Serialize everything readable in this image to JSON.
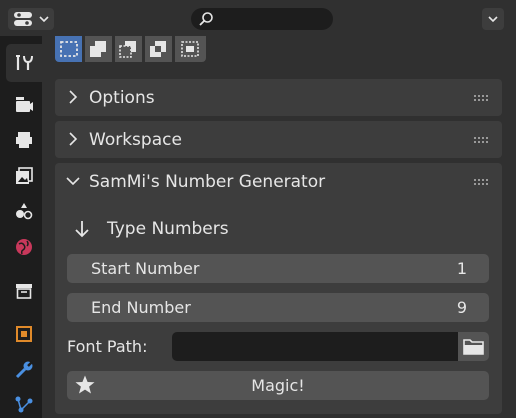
{
  "header": {
    "editor_type_icon": "properties-editor-icon",
    "search": {
      "value": "",
      "placeholder": ""
    },
    "menu_icon": "chevron-down-icon"
  },
  "tabs": [
    {
      "icon": "tool-icon",
      "active": true
    },
    {
      "icon": "render-icon",
      "active": false
    },
    {
      "icon": "output-icon",
      "active": false
    },
    {
      "icon": "view-layer-icon",
      "active": false
    },
    {
      "icon": "scene-icon",
      "active": false
    },
    {
      "icon": "world-icon",
      "active": false
    },
    {
      "icon": "collection-icon",
      "active": false
    },
    {
      "icon": "object-icon",
      "active": false
    },
    {
      "icon": "modifier-icon",
      "active": false
    },
    {
      "icon": "particles-icon",
      "active": false
    }
  ],
  "selection_modes": [
    {
      "icon": "select-new-icon",
      "selected": true
    },
    {
      "icon": "select-extend-icon",
      "selected": false
    },
    {
      "icon": "select-subtract-icon",
      "selected": false
    },
    {
      "icon": "select-difference-icon",
      "selected": false
    },
    {
      "icon": "select-intersect-icon",
      "selected": false
    }
  ],
  "panels": {
    "options": {
      "title": "Options",
      "collapsed": true
    },
    "workspace": {
      "title": "Workspace",
      "collapsed": true
    },
    "generator": {
      "title": "SamMi's Number Generator",
      "collapsed": false,
      "type_numbers_label": "Type Numbers",
      "start": {
        "label": "Start Number",
        "value": "1"
      },
      "end": {
        "label": "End Number",
        "value": "9"
      },
      "font_path": {
        "label": "Font Path:",
        "value": ""
      },
      "magic_label": "Magic!"
    }
  },
  "colors": {
    "accent": "#4772b3",
    "panel": "#3d3d3d",
    "field": "#545454",
    "background": "#303030",
    "dark": "#1d1d1d"
  }
}
